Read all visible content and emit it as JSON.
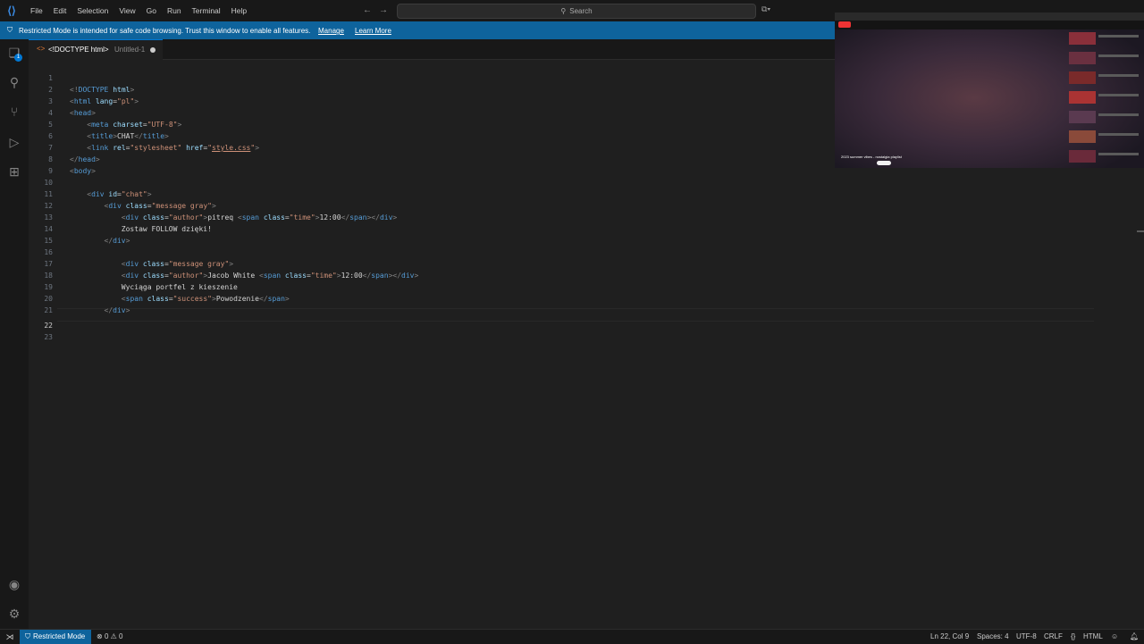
{
  "titlebar": {
    "menu": [
      "File",
      "Edit",
      "Selection",
      "View",
      "Go",
      "Run",
      "Terminal",
      "Help"
    ],
    "search_placeholder": "Search"
  },
  "banner": {
    "message": "Restricted Mode is intended for safe code browsing. Trust this window to enable all features.",
    "manage": "Manage",
    "learn_more": "Learn More"
  },
  "tab": {
    "name": "<!DOCTYPE html>",
    "sub": "Untitled-1"
  },
  "editor": {
    "line_numbers": [
      "1",
      "2",
      "3",
      "4",
      "5",
      "6",
      "7",
      "8",
      "9",
      "10",
      "11",
      "12",
      "13",
      "14",
      "15",
      "16",
      "17",
      "18",
      "19",
      "20",
      "21",
      "22",
      "23"
    ],
    "active_line": "22"
  },
  "video": {
    "caption": "2023 summer vibes - nostalgia playlist"
  },
  "activity": {
    "badge": "1"
  },
  "statusbar": {
    "restricted": "Restricted Mode",
    "errors": "0",
    "warnings": "0",
    "position": "Ln 22, Col 9",
    "spaces": "Spaces: 4",
    "encoding": "UTF-8",
    "eol": "CRLF",
    "braces": "{}",
    "language": "HTML"
  }
}
